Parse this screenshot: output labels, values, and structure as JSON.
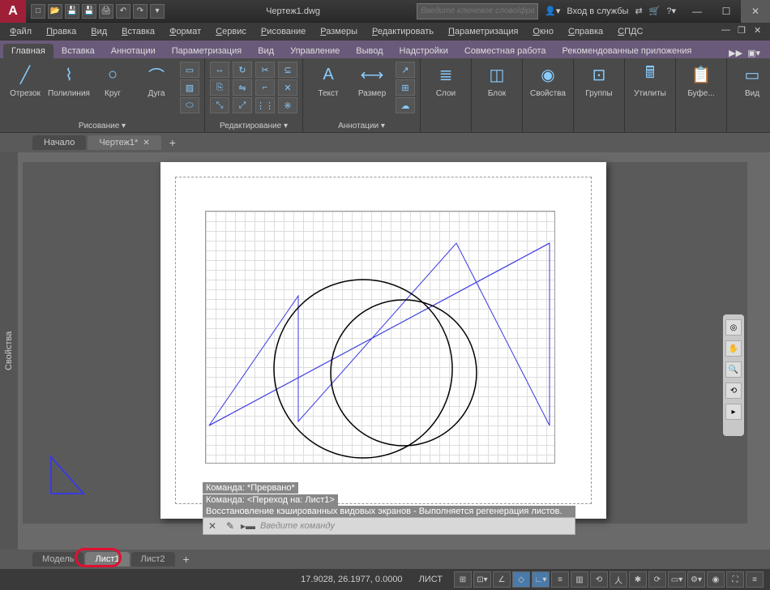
{
  "title": "Чертеж1.dwg",
  "search_placeholder": "Введите ключевое слово/фразу",
  "signin_label": "Вход в службы",
  "menu": [
    "Файл",
    "Правка",
    "Вид",
    "Вставка",
    "Формат",
    "Сервис",
    "Рисование",
    "Размеры",
    "Редактировать",
    "Параметризация",
    "Окно",
    "Справка",
    "СПДС"
  ],
  "ribbon_tabs": [
    "Главная",
    "Вставка",
    "Аннотации",
    "Параметризация",
    "Вид",
    "Управление",
    "Вывод",
    "Надстройки",
    "Совместная работа",
    "Рекомендованные приложения"
  ],
  "panels": {
    "draw": {
      "title": "Рисование ▾",
      "items": [
        "Отрезок",
        "Полилиния",
        "Круг",
        "Дуга"
      ]
    },
    "modify": {
      "title": "Редактирование ▾"
    },
    "annotation": {
      "title": "Аннотации ▾",
      "items": [
        "Текст",
        "Размер"
      ]
    },
    "layers": {
      "title": "Слои"
    },
    "block": {
      "title": "Блок"
    },
    "props": {
      "title": "Свойства"
    },
    "groups": {
      "title": "Группы"
    },
    "utils": {
      "title": "Утилиты"
    },
    "clipboard": {
      "title": "Буфе..."
    },
    "view": {
      "title": "Вид"
    }
  },
  "file_tabs": {
    "start": "Начало",
    "current": "Чертеж1*"
  },
  "props_panel": "Свойства",
  "cmd_history": [
    "Команда: *Прервано*",
    "Команда:  <Переход на: Лист1>",
    "Восстановление кэшированных видовых экранов - Выполняется регенерация листов."
  ],
  "cmd_placeholder": "Введите команду",
  "layout_tabs": [
    "Модель",
    "Лист1",
    "Лист2"
  ],
  "status": {
    "coords": "17.9028, 26.1977, 0.0000",
    "mode": "ЛИСТ"
  }
}
